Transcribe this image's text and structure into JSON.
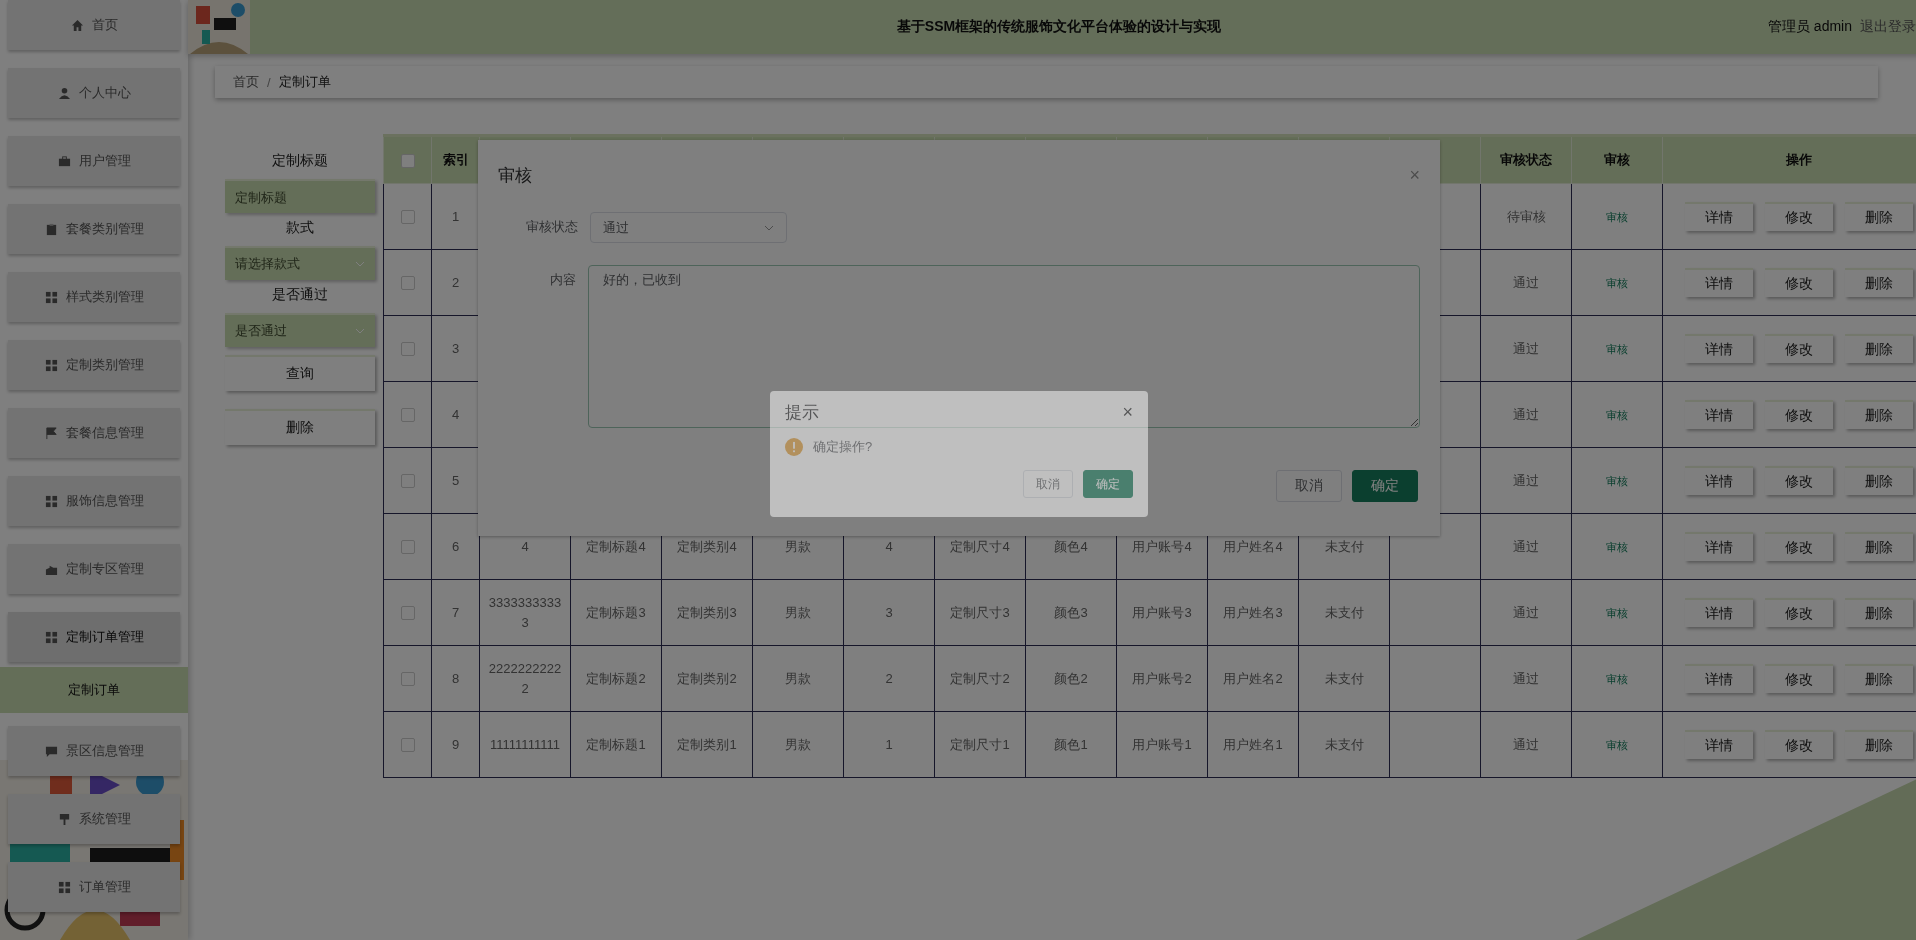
{
  "sidebar": {
    "items": [
      {
        "label": "首页",
        "selected": false
      },
      {
        "label": "个人中心",
        "selected": false
      },
      {
        "label": "用户管理",
        "selected": false
      },
      {
        "label": "套餐类别管理",
        "selected": false
      },
      {
        "label": "样式类别管理",
        "selected": false
      },
      {
        "label": "定制类别管理",
        "selected": false
      },
      {
        "label": "套餐信息管理",
        "selected": false
      },
      {
        "label": "服饰信息管理",
        "selected": false
      },
      {
        "label": "定制专区管理",
        "selected": false
      },
      {
        "label": "定制订单管理",
        "selected": false,
        "expanded": true,
        "children": [
          {
            "label": "定制订单",
            "selected": true
          }
        ]
      },
      {
        "label": "景区信息管理",
        "selected": false
      },
      {
        "label": "系统管理",
        "selected": false
      },
      {
        "label": "订单管理",
        "selected": false
      }
    ]
  },
  "header": {
    "title": "基于SSM框架的传统服饰文化平台体验的设计与实现",
    "user": "管理员 admin",
    "logout": "退出登录"
  },
  "breadcrumb": {
    "items": [
      "首页",
      "定制订单"
    ],
    "separator": "/"
  },
  "search": {
    "fields": [
      {
        "kind": "input",
        "label": "定制标题",
        "placeholder": "定制标题"
      },
      {
        "kind": "select",
        "label": "款式",
        "placeholder": "请选择款式"
      },
      {
        "kind": "select",
        "label": "是否通过",
        "placeholder": "是否通过"
      }
    ],
    "buttons": [
      "查询",
      "删除"
    ]
  },
  "table": {
    "header_checked": false,
    "columns": {
      "index": "索引",
      "status": "审核状态",
      "audit": "审核",
      "actions": "操作"
    },
    "rows": [
      {
        "checked": false,
        "index": "1",
        "status": "待审核",
        "audit": "审核",
        "actions": [
          "详情",
          "修改",
          "删除"
        ]
      },
      {
        "checked": false,
        "index": "2",
        "status": "通过",
        "audit": "审核",
        "actions": [
          "详情",
          "修改",
          "删除"
        ]
      },
      {
        "checked": false,
        "index": "3",
        "status": "通过",
        "audit": "审核",
        "actions": [
          "详情",
          "修改",
          "删除"
        ]
      },
      {
        "checked": false,
        "index": "4",
        "status": "通过",
        "audit": "审核",
        "actions": [
          "详情",
          "修改",
          "删除"
        ]
      },
      {
        "checked": false,
        "index": "5",
        "status": "通过",
        "audit": "审核",
        "actions": [
          "详情",
          "修改",
          "删除"
        ]
      },
      {
        "checked": false,
        "index": "6",
        "cells": [
          "4",
          "定制标题4",
          "定制类别4",
          "男款",
          "4",
          "定制尺寸4",
          "颜色4",
          "用户账号4",
          "用户姓名4",
          "未支付"
        ],
        "status": "通过",
        "audit": "审核",
        "actions": [
          "详情",
          "修改",
          "删除"
        ]
      },
      {
        "checked": false,
        "index": "7",
        "cells": [
          "33333333333",
          "定制标题3",
          "定制类别3",
          "男款",
          "3",
          "定制尺寸3",
          "颜色3",
          "用户账号3",
          "用户姓名3",
          "未支付"
        ],
        "status": "通过",
        "audit": "审核",
        "actions": [
          "详情",
          "修改",
          "删除"
        ]
      },
      {
        "checked": false,
        "index": "8",
        "cells": [
          "22222222222",
          "定制标题2",
          "定制类别2",
          "男款",
          "2",
          "定制尺寸2",
          "颜色2",
          "用户账号2",
          "用户姓名2",
          "未支付"
        ],
        "status": "通过",
        "audit": "审核",
        "actions": [
          "详情",
          "修改",
          "删除"
        ]
      },
      {
        "checked": false,
        "index": "9",
        "cells": [
          "11111111111",
          "定制标题1",
          "定制类别1",
          "男款",
          "1",
          "定制尺寸1",
          "颜色1",
          "用户账号1",
          "用户姓名1",
          "未支付"
        ],
        "status": "通过",
        "audit": "审核",
        "actions": [
          "详情",
          "修改",
          "删除"
        ]
      }
    ]
  },
  "dialog": {
    "title": "审核",
    "close": "×",
    "fields": [
      {
        "kind": "select",
        "label": "审核状态",
        "value": "通过"
      },
      {
        "kind": "textarea",
        "label": "内容",
        "value": "好的，已收到"
      }
    ],
    "buttons": [
      {
        "label": "取消",
        "primary": false
      },
      {
        "label": "确定",
        "primary": true
      }
    ]
  },
  "message_box": {
    "title": "提示",
    "close": "×",
    "message": "确定操作?",
    "buttons": [
      {
        "label": "取消",
        "primary": false
      },
      {
        "label": "确定",
        "primary": true
      }
    ]
  }
}
